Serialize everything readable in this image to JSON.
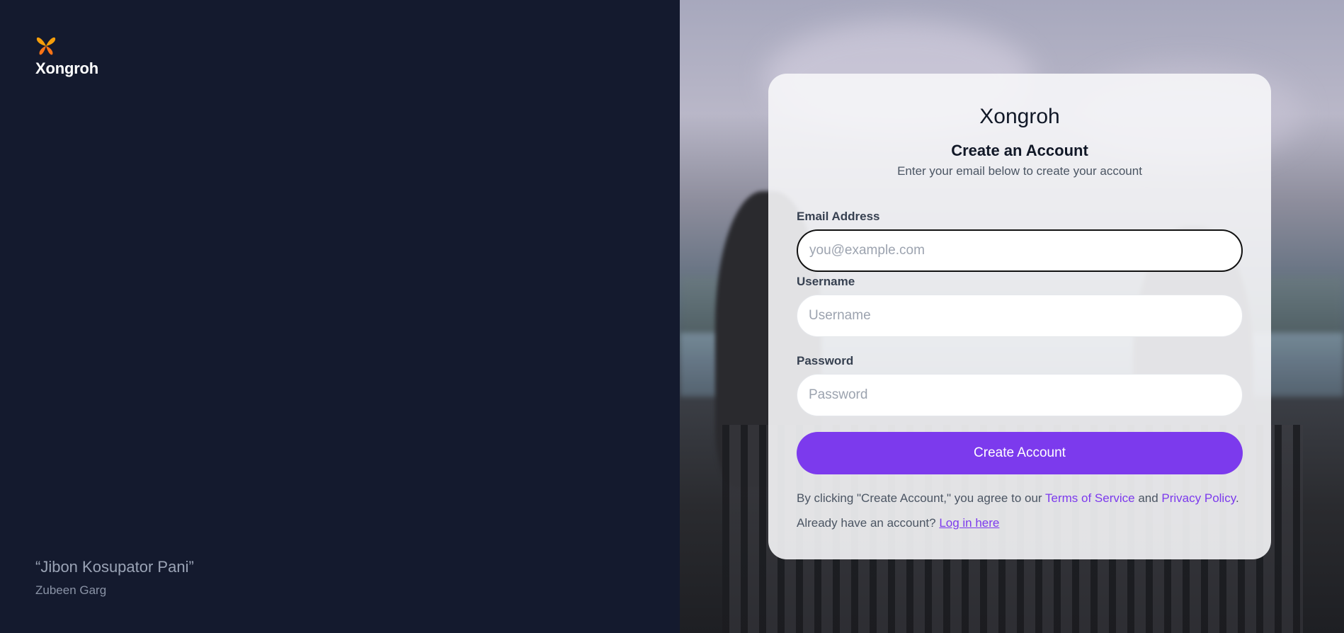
{
  "brand": {
    "name": "Xongroh",
    "logo_icon": "butterfly-icon",
    "logo_color": "#f59e0b"
  },
  "quote": {
    "text": "“Jibon Kosupator Pani”",
    "author": "Zubeen Garg"
  },
  "card": {
    "title": "Xongroh",
    "subtitle": "Create an Account",
    "description": "Enter your email below to create your account"
  },
  "form": {
    "email": {
      "label": "Email Address",
      "placeholder": "you@example.com",
      "value": ""
    },
    "username": {
      "label": "Username",
      "placeholder": "Username",
      "value": ""
    },
    "password": {
      "label": "Password",
      "placeholder": "Password",
      "value": ""
    },
    "submit_label": "Create Account"
  },
  "legal": {
    "prefix": "By clicking \"Create Account,\" you agree to our ",
    "terms_link": "Terms of Service",
    "and": " and ",
    "privacy_link": "Privacy Policy",
    "suffix": "."
  },
  "login": {
    "prompt": "Already have an account? ",
    "link": "Log in here"
  },
  "colors": {
    "accent": "#7c3aed",
    "left_bg": "#141a2e",
    "card_bg": "#f6f6f8"
  }
}
